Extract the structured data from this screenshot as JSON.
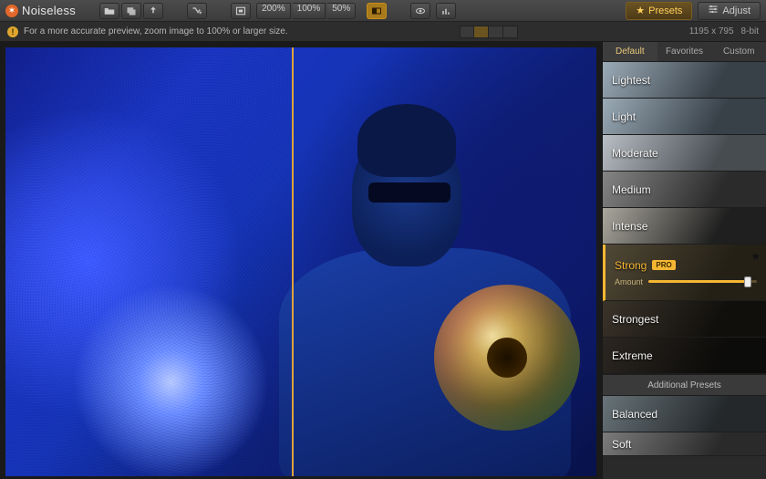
{
  "app": {
    "name": "Noiseless",
    "badge_glyph": "✶"
  },
  "toolbar": {
    "zoom": [
      "200%",
      "100%",
      "50%"
    ],
    "presets_label": "Presets",
    "adjust_label": "Adjust"
  },
  "infobar": {
    "hint": "For a more accurate preview, zoom image to 100% or larger size.",
    "dimensions": "1195 x 795",
    "bit_depth": "8-bit"
  },
  "tabs": {
    "default": "Default",
    "favorites": "Favorites",
    "custom": "Custom",
    "selected": "default"
  },
  "presets": {
    "items": [
      {
        "label": "Lightest",
        "thumb": "th-sky"
      },
      {
        "label": "Light",
        "thumb": "th-sky"
      },
      {
        "label": "Moderate",
        "thumb": "th-clouds"
      },
      {
        "label": "Medium",
        "thumb": "th-window"
      },
      {
        "label": "Intense",
        "thumb": "th-sunset"
      },
      {
        "label": "Strong",
        "thumb": "th-lamp",
        "selected": true,
        "pro": true,
        "amount_label": "Amount"
      },
      {
        "label": "Strongest",
        "thumb": "th-candle"
      },
      {
        "label": "Extreme",
        "thumb": "th-fire"
      }
    ],
    "additional_header": "Additional Presets",
    "additional": [
      {
        "label": "Balanced",
        "thumb": "th-sea"
      },
      {
        "label": "Soft",
        "thumb": "th-city"
      }
    ],
    "pro_badge": "PRO"
  }
}
